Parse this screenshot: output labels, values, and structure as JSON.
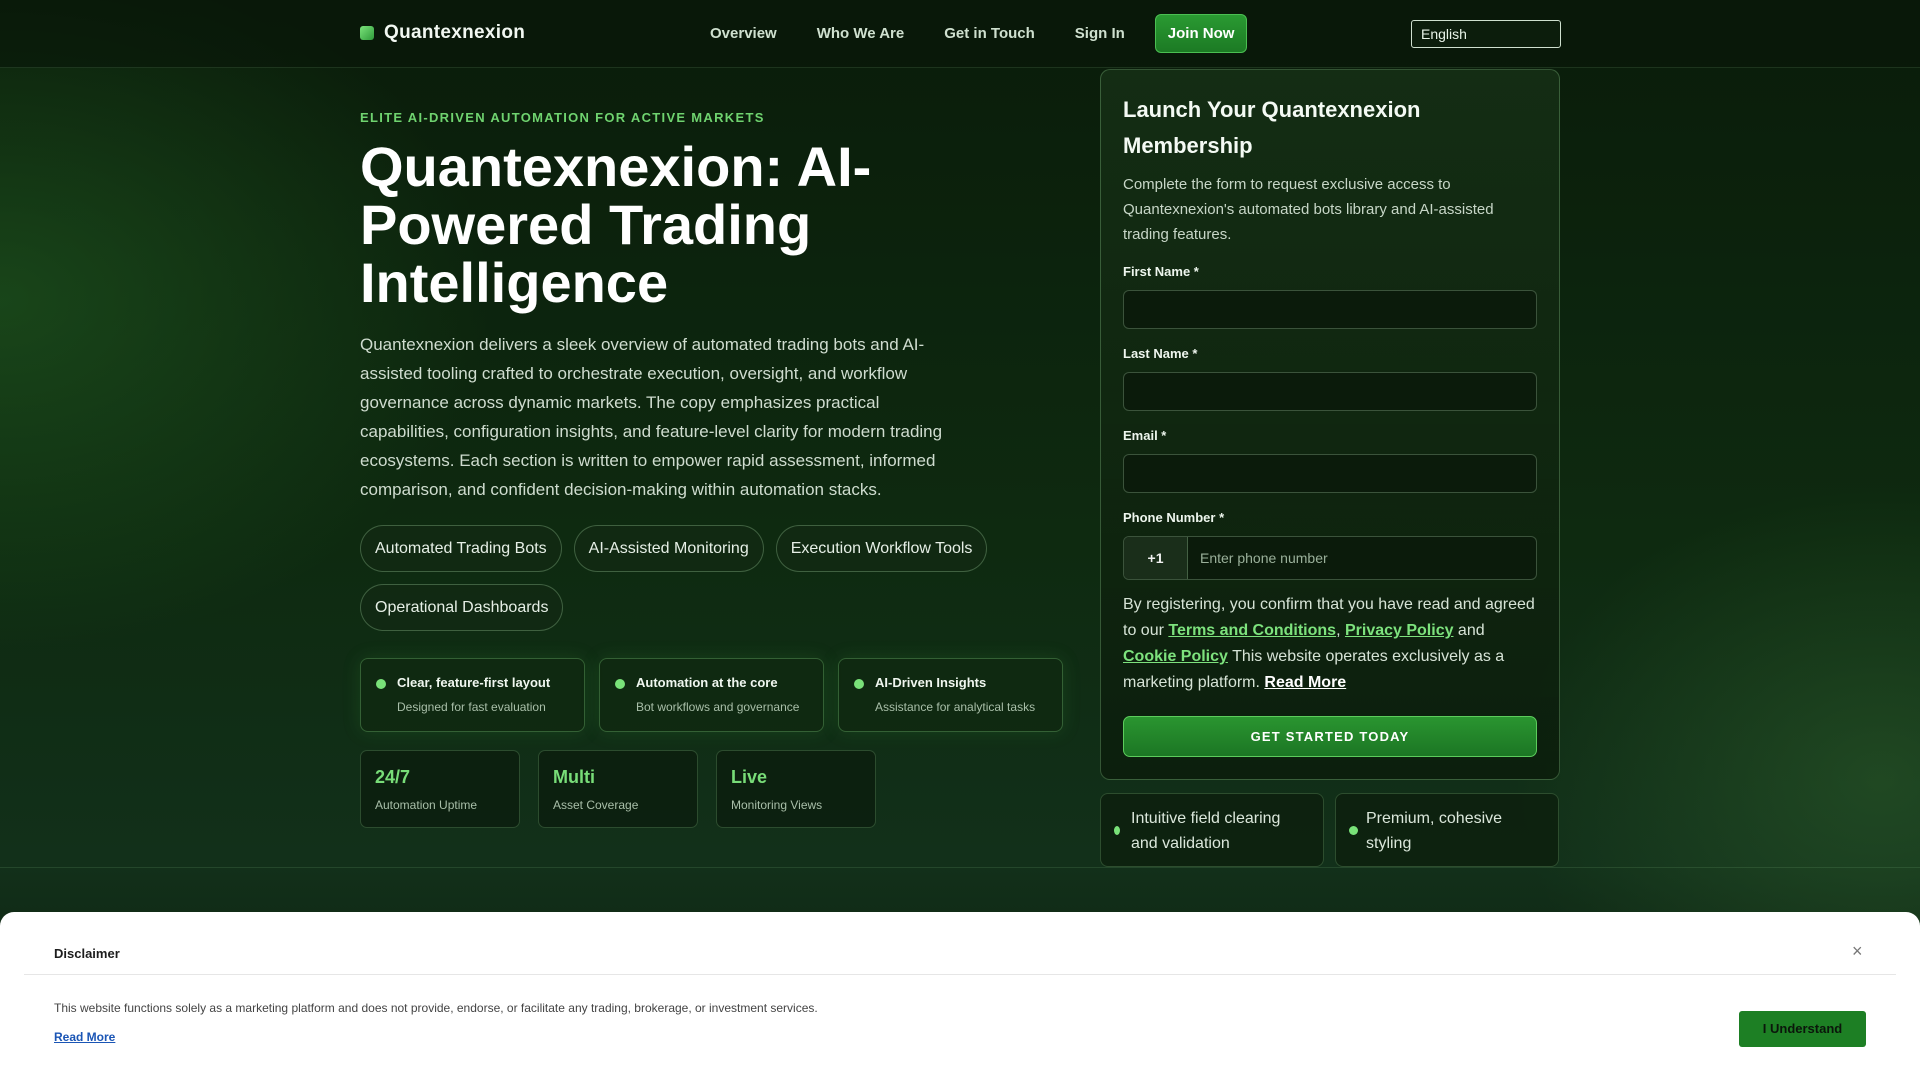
{
  "header": {
    "brand": "Quantexnexion",
    "nav": [
      "Overview",
      "Who We Are",
      "Get in Touch",
      "Sign In"
    ],
    "join_label": "Join Now",
    "language": "English"
  },
  "hero": {
    "eyebrow": "ELITE AI-DRIVEN AUTOMATION FOR ACTIVE MARKETS",
    "title": "Quantexnexion: AI-Powered Trading Intelligence",
    "description": "Quantexnexion delivers a sleek overview of automated trading bots and AI-assisted tooling crafted to orchestrate execution, oversight, and workflow governance across dynamic markets. The copy emphasizes practical capabilities, configuration insights, and feature-level clarity for modern trading ecosystems. Each section is written to empower rapid assessment, informed comparison, and confident decision-making within automation stacks.",
    "tags": [
      "Automated Trading Bots",
      "AI-Assisted Monitoring",
      "Execution Workflow Tools",
      "Operational Dashboards"
    ],
    "features": [
      {
        "title": "Clear, feature-first layout",
        "sub": "Designed for fast evaluation"
      },
      {
        "title": "Automation at the core",
        "sub": "Bot workflows and governance"
      },
      {
        "title": "AI-Driven Insights",
        "sub": "Assistance for analytical tasks"
      }
    ],
    "stats": [
      {
        "value": "24/7",
        "label": "Automation Uptime"
      },
      {
        "value": "Multi",
        "label": "Asset Coverage"
      },
      {
        "value": "Live",
        "label": "Monitoring Views"
      }
    ]
  },
  "form": {
    "title": "Launch Your Quantexnexion Membership",
    "subtitle": "Complete the form to request exclusive access to Quantexnexion's automated bots library and AI-assisted trading features.",
    "first_name_label": "First Name *",
    "last_name_label": "Last Name *",
    "email_label": "Email *",
    "phone_label": "Phone Number *",
    "phone_code": "+1",
    "phone_placeholder": "Enter phone number",
    "consent_1": "By registering, you confirm that you have read and agreed to our ",
    "terms": "Terms and Conditions",
    "comma": ", ",
    "privacy": "Privacy Policy",
    "and": " and ",
    "cookie": "Cookie Policy",
    "consent_2": " This website operates exclusively as a marketing platform. ",
    "read_more": "Read More",
    "cta": "GET STARTED TODAY"
  },
  "mini_cards": [
    "Intuitive field clearing and validation",
    "Premium, cohesive styling"
  ],
  "disclaimer": {
    "title": "Disclaimer",
    "close": "×",
    "text": "This website functions solely as a marketing platform and does not provide, endorse, or facilitate any trading, brokerage, or investment services.",
    "read_more": "Read More",
    "button": "I Understand"
  }
}
